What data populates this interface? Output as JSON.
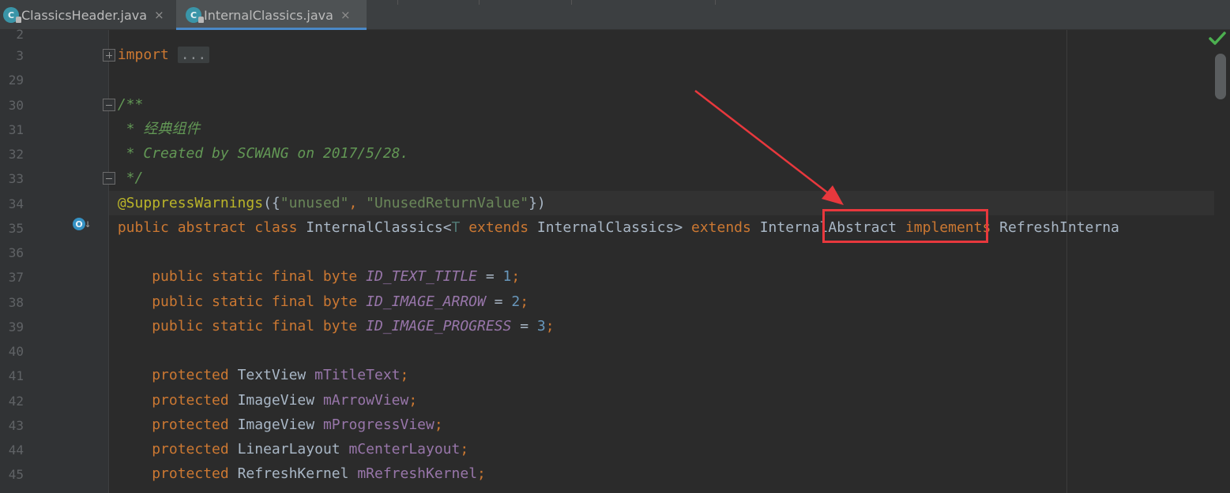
{
  "tabs": [
    {
      "label": "ClassicsHeader.java",
      "icon": "java-class-icon",
      "close": "×",
      "active": false
    },
    {
      "label": "InternalClassics.java",
      "icon": "java-class-icon",
      "close": "×",
      "active": true
    }
  ],
  "tab_icon_letter": "C",
  "gutter": {
    "line_numbers": [
      "2",
      "3",
      "29",
      "30",
      "31",
      "32",
      "33",
      "34",
      "35",
      "36",
      "37",
      "38",
      "39",
      "40",
      "41",
      "42",
      "43",
      "44",
      "45"
    ],
    "override_icon_letter": "O",
    "override_arrow": "↓"
  },
  "code": {
    "import_kw": "import",
    "import_fold": "...",
    "doc_open": "/**",
    "doc_line1": " * 经典组件",
    "doc_line2": " * Created by SCWANG on 2017/5/28.",
    "doc_close": " */",
    "ann_name": "@SuppressWarnings",
    "ann_open": "({",
    "ann_str1": "\"unused\"",
    "ann_comma": ", ",
    "ann_str2": "\"UnusedReturnValue\"",
    "ann_close": "})",
    "cls_public": "public",
    "cls_abstract": "abstract",
    "cls_class": "class",
    "cls_name": "InternalClassics",
    "cls_lt": "<",
    "cls_tparam": "T",
    "cls_extends1": "extends",
    "cls_bound": "InternalClassics",
    "cls_gt": ">",
    "cls_extends2": "extends",
    "cls_super": "InternalAbstract",
    "cls_implements": "implements",
    "cls_iface": "RefreshInterna",
    "constants": [
      {
        "mods": "public static final byte",
        "name": "ID_TEXT_TITLE",
        "eq": " = ",
        "value": "1",
        "semi": ";"
      },
      {
        "mods": "public static final byte",
        "name": "ID_IMAGE_ARROW",
        "eq": " = ",
        "value": "2",
        "semi": ";"
      },
      {
        "mods": "public static final byte",
        "name": "ID_IMAGE_PROGRESS",
        "eq": " = ",
        "value": "3",
        "semi": ";"
      }
    ],
    "fields": [
      {
        "mod": "protected",
        "type": "TextView",
        "name": "mTitleText",
        "semi": ";"
      },
      {
        "mod": "protected",
        "type": "ImageView",
        "name": "mArrowView",
        "semi": ";"
      },
      {
        "mod": "protected",
        "type": "ImageView",
        "name": "mProgressView",
        "semi": ";"
      },
      {
        "mod": "protected",
        "type": "LinearLayout",
        "name": "mCenterLayout",
        "semi": ";"
      },
      {
        "mod": "protected",
        "type": "RefreshKernel",
        "name": "mRefreshKernel",
        "semi": ";"
      }
    ]
  },
  "colors": {
    "keyword": "#cc7832",
    "string": "#6a8759",
    "comment": "#629755",
    "annotation": "#bbb529",
    "constant": "#9876aa",
    "number": "#6897bb",
    "highlight": "#e8383d",
    "inspection_ok": "#4caf50"
  }
}
